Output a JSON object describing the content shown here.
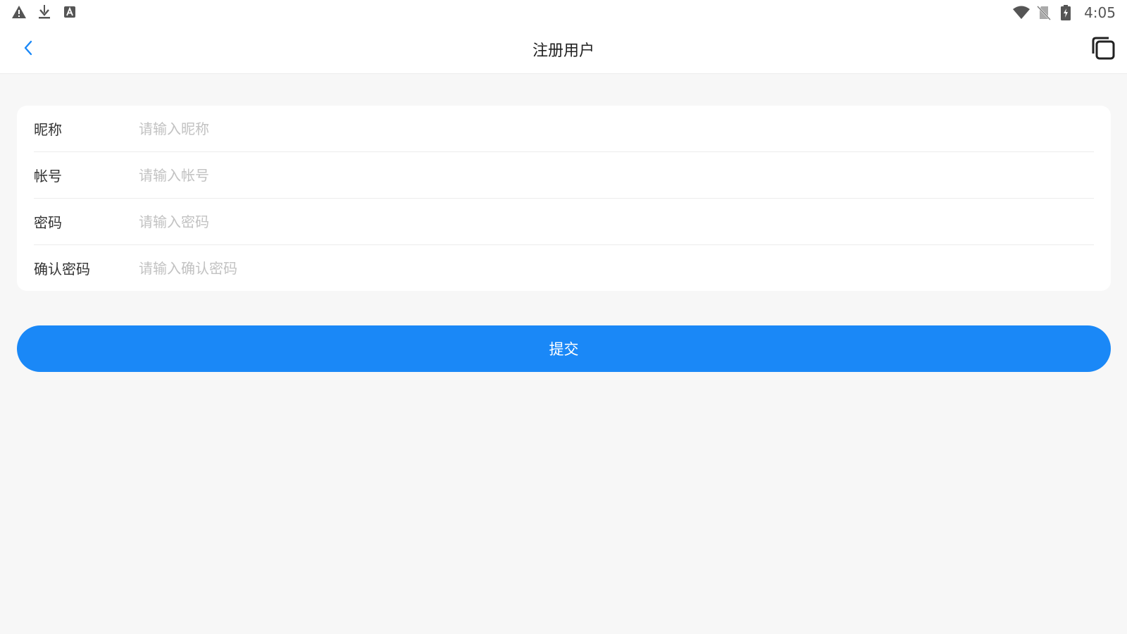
{
  "status_bar": {
    "time": "4:05",
    "left_icons": [
      "warning-icon",
      "download-icon",
      "keyboard-a-icon"
    ],
    "right_icons": [
      "wifi-icon",
      "no-sim-icon",
      "battery-charging-icon"
    ]
  },
  "nav": {
    "title": "注册用户",
    "back_icon": "chevron-left-icon",
    "window_icon": "multi-window-icon",
    "accent_color": "#1a88f7"
  },
  "form": {
    "fields": [
      {
        "label": "昵称",
        "placeholder": "请输入昵称",
        "value": ""
      },
      {
        "label": "帐号",
        "placeholder": "请输入帐号",
        "value": ""
      },
      {
        "label": "密码",
        "placeholder": "请输入密码",
        "value": ""
      },
      {
        "label": "确认密码",
        "placeholder": "请输入确认密码",
        "value": ""
      }
    ]
  },
  "submit": {
    "label": "提交",
    "color": "#1a88f7"
  }
}
